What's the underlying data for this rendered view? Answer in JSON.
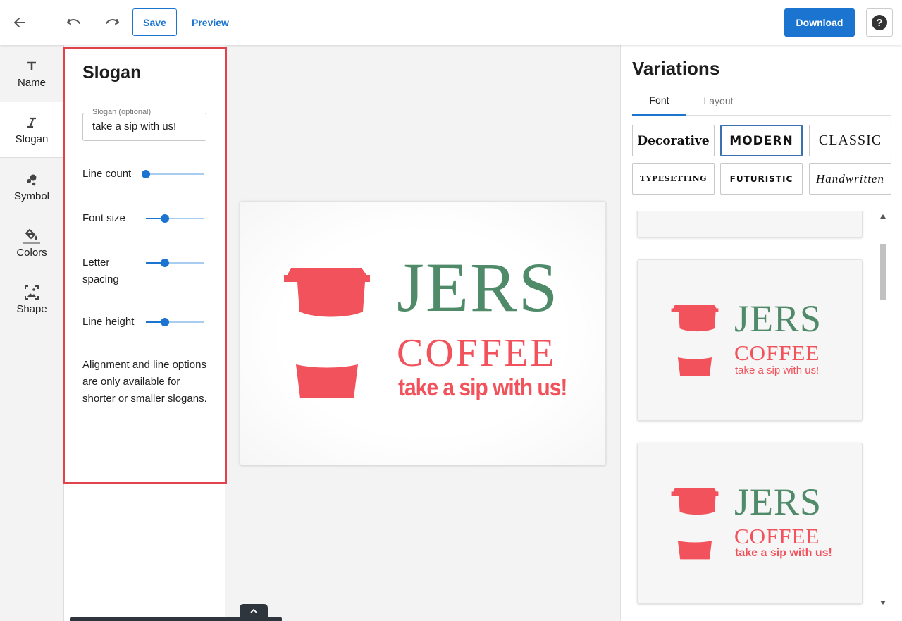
{
  "toolbar": {
    "save_label": "Save",
    "preview_label": "Preview",
    "download_label": "Download",
    "help_label": "?"
  },
  "rail": {
    "items": [
      {
        "label": "Name",
        "icon": "text-icon"
      },
      {
        "label": "Slogan",
        "icon": "italic-icon"
      },
      {
        "label": "Symbol",
        "icon": "shapes-icon"
      },
      {
        "label": "Colors",
        "icon": "paint-bucket-icon"
      },
      {
        "label": "Shape",
        "icon": "image-frame-icon"
      }
    ],
    "active": "Slogan"
  },
  "panel": {
    "title": "Slogan",
    "slogan_field_label": "Slogan (optional)",
    "slogan_value": "take a sip with us!",
    "controls": [
      {
        "label": "Line count",
        "value": 0.0
      },
      {
        "label": "Font size",
        "value": 0.33
      },
      {
        "label": "Letter\nspacing",
        "value": 0.33
      },
      {
        "label": "Line height",
        "value": 0.33
      }
    ],
    "note": "Alignment and line options are only available for shorter or smaller slogans."
  },
  "logo": {
    "name_line1": "JERS",
    "name_line2": "COFFEE",
    "slogan": "take a sip with us!",
    "name_color": "#4f8a69",
    "accent_color": "#f2525b",
    "symbol": "coffee-cup-icon"
  },
  "variations": {
    "title": "Variations",
    "tabs": [
      {
        "label": "Font",
        "active": true
      },
      {
        "label": "Layout",
        "active": false
      }
    ],
    "font_styles": [
      {
        "label": "Decorative",
        "selected": false
      },
      {
        "label": "MODERN",
        "selected": true
      },
      {
        "label": "CLASSIC",
        "selected": false
      },
      {
        "label": "TYPESETTING",
        "selected": false
      },
      {
        "label": "FUTURISTIC",
        "selected": false
      },
      {
        "label": "Handwritten",
        "selected": false
      }
    ]
  },
  "colors": {
    "primary": "#1b74d0",
    "highlight": "#e2424c"
  }
}
